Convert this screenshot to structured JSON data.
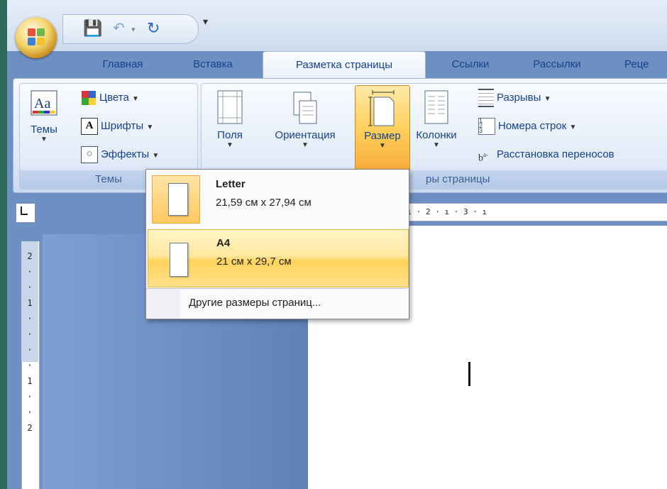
{
  "tabs": [
    "Главная",
    "Вставка",
    "Разметка страницы",
    "Ссылки",
    "Рассылки",
    "Реце"
  ],
  "active_tab": "Разметка страницы",
  "quick_access": {
    "icons": [
      "save-icon",
      "undo-icon",
      "redo-icon",
      "customize-qat-icon"
    ]
  },
  "ribbon": {
    "themes_group": {
      "label": "Темы",
      "themes_button": "Темы",
      "colors": "Цвета",
      "fonts": "Шрифты",
      "effects": "Эффекты"
    },
    "page_setup_group": {
      "label": "ры страницы",
      "margins": "Поля",
      "orientation": "Ориентация",
      "size": "Размер",
      "columns": "Колонки",
      "breaks": "Разрывы",
      "line_numbers": "Номера строк",
      "hyphenation": "Расстановка переносов"
    }
  },
  "ruler": {
    "horizontal": "1 · ı · ⧖ · ı · 1 · ı · 2 · ı · 3 · ı",
    "vertical": [
      "2",
      "·",
      "·",
      "1",
      "·",
      "·",
      "·",
      "·",
      "1",
      "·",
      "·",
      "2"
    ]
  },
  "size_menu": {
    "items": [
      {
        "name": "Letter",
        "size": "21,59 см x 27,94 см"
      },
      {
        "name": "A4",
        "size": "21 см x 29,7 см"
      }
    ],
    "more": "Другие размеры страниц..."
  },
  "colors": {
    "accent": "#ffd45c",
    "ribbon_bg": "#dfe9f7",
    "workspace": "#6e8fc2",
    "text": "#15428b"
  }
}
